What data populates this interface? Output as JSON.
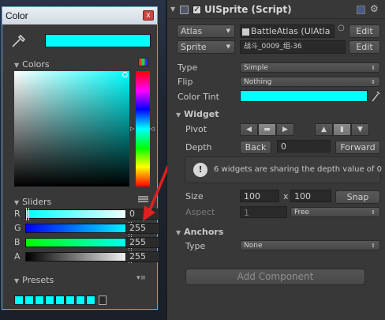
{
  "color_window": {
    "title": "Color",
    "close_glyph": "x",
    "current_color": "#00ffff",
    "colors_label": "Colors",
    "sliders_label": "Sliders",
    "sliders": [
      {
        "label": "R",
        "value": "0",
        "level": 0.0
      },
      {
        "label": "G",
        "value": "255",
        "level": 1.0
      },
      {
        "label": "B",
        "value": "255",
        "level": 1.0
      },
      {
        "label": "A",
        "value": "255",
        "level": 1.0
      }
    ],
    "presets_label": "Presets",
    "preset_colors": [
      "#00ffff",
      "#00ffff",
      "#00ffff",
      "#00ffff",
      "#00ffff",
      "#00ffff",
      "#00ffff",
      "#00ffff"
    ]
  },
  "inspector": {
    "component_title": "UISprite (Script)",
    "atlas_label": "Atlas",
    "atlas_value": "BattleAtlas (UIAtla",
    "atlas_edit": "Edit",
    "sprite_label": "Sprite",
    "sprite_value": "战斗_0009_组-36",
    "sprite_edit": "Edit",
    "type_label": "Type",
    "type_value": "Simple",
    "flip_label": "Flip",
    "flip_value": "Nothing",
    "tint_label": "Color Tint",
    "tint_color": "#00ffff",
    "widget_label": "Widget",
    "pivot_label": "Pivot",
    "depth_label": "Depth",
    "depth_back": "Back",
    "depth_value": "0",
    "depth_forward": "Forward",
    "info_icon": "!",
    "info_text": "6 widgets are sharing the depth value of 0",
    "size_label": "Size",
    "size_w": "100",
    "size_x": "x",
    "size_h": "100",
    "snap": "Snap",
    "aspect_label": "Aspect",
    "aspect_value": "1",
    "aspect_mode": "Free",
    "anchors_label": "Anchors",
    "anchors_type_label": "Type",
    "anchors_type_value": "None",
    "add_component": "Add Component"
  },
  "colors": {
    "accent": "#00ffff",
    "annotation_arrow": "#e02020"
  }
}
